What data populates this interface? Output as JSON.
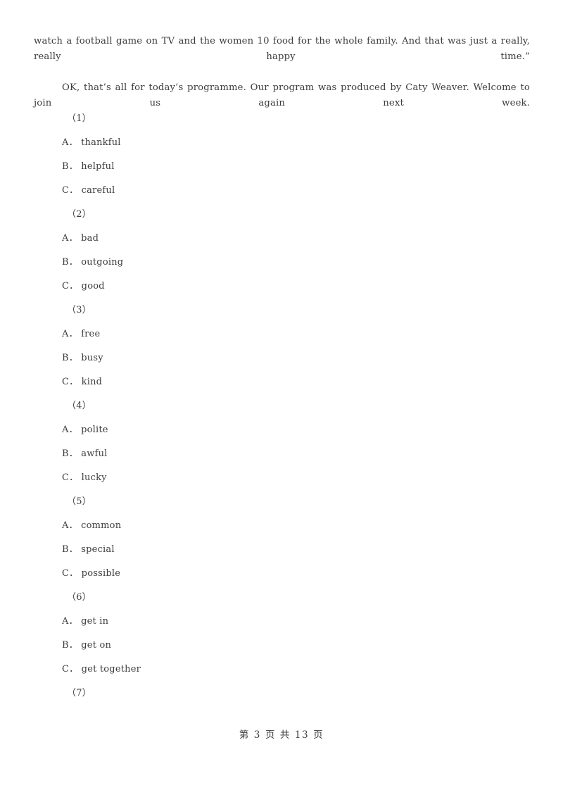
{
  "document": {
    "paragraphs": [
      "watch a football game on TV and the women 10 food for the whole family. And that was just a really, really happy time.”",
      "OK, that’s all for today’s programme. Our program was produced by Caty Weaver. Welcome to join us again next week."
    ],
    "questions": [
      {
        "number": "（1）",
        "options": [
          "A． thankful",
          "B． helpful",
          "C． careful"
        ]
      },
      {
        "number": "（2）",
        "options": [
          "A． bad",
          "B． outgoing",
          "C． good"
        ]
      },
      {
        "number": "（3）",
        "options": [
          "A． free",
          "B． busy",
          "C． kind"
        ]
      },
      {
        "number": "（4）",
        "options": [
          "A． polite",
          "B． awful",
          "C． lucky"
        ]
      },
      {
        "number": "（5）",
        "options": [
          "A． common",
          "B． special",
          "C． possible"
        ]
      },
      {
        "number": "（6）",
        "options": [
          "A． get in",
          "B． get on",
          "C． get together"
        ]
      },
      {
        "number": "（7）",
        "options": []
      }
    ],
    "footer": {
      "text": "第 3 页 共 13 页",
      "current_page": "3",
      "total_pages": "13"
    }
  }
}
